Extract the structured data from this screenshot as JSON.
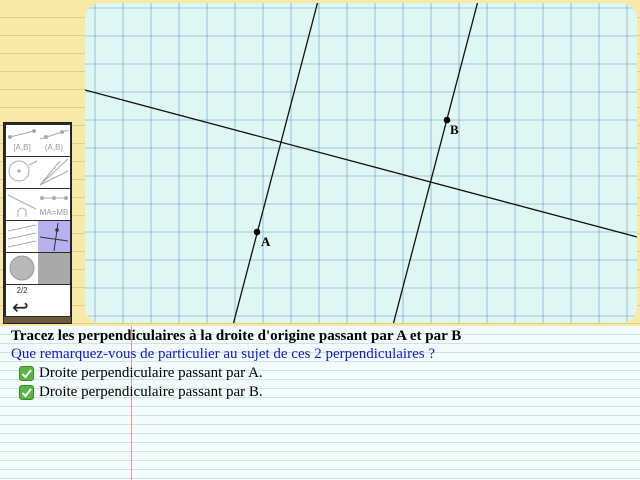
{
  "board": {
    "point_a_label": "A",
    "point_b_label": "B",
    "colors": {
      "background": "#dff7f3",
      "grid": "#1e5aa8",
      "line": "#111111"
    }
  },
  "toolbar": {
    "tools": [
      {
        "name": "segment-tool",
        "label": "[A,B]"
      },
      {
        "name": "ray-tool",
        "label": "(A,B)"
      },
      {
        "name": "circle-tool",
        "label": ""
      },
      {
        "name": "lines-tool",
        "label": ""
      },
      {
        "name": "angle-tool",
        "label": ""
      },
      {
        "name": "midpoint-tool",
        "label": "MA=MB"
      },
      {
        "name": "parallel-tool",
        "label": ""
      },
      {
        "name": "perpendicular-tool",
        "label": ""
      },
      {
        "name": "fill-tool",
        "label": ""
      },
      {
        "name": "color-tool",
        "label": ""
      },
      {
        "name": "page-indicator",
        "label": "2/2"
      },
      {
        "name": "blank-tool",
        "label": ""
      }
    ],
    "page": "2/2",
    "undo_symbol": "↩"
  },
  "exercise": {
    "instruction": "Tracez les perpendiculaires à la droite d'origine passant par A et par B",
    "question": "Que remarquez-vous de particulier au sujet de ces 2 perpendiculaires ?",
    "answers": [
      {
        "text": "Droite perpendiculaire passant par A.",
        "status": "correct"
      },
      {
        "text": "Droite perpendiculaire passant par B.",
        "status": "correct"
      }
    ]
  }
}
